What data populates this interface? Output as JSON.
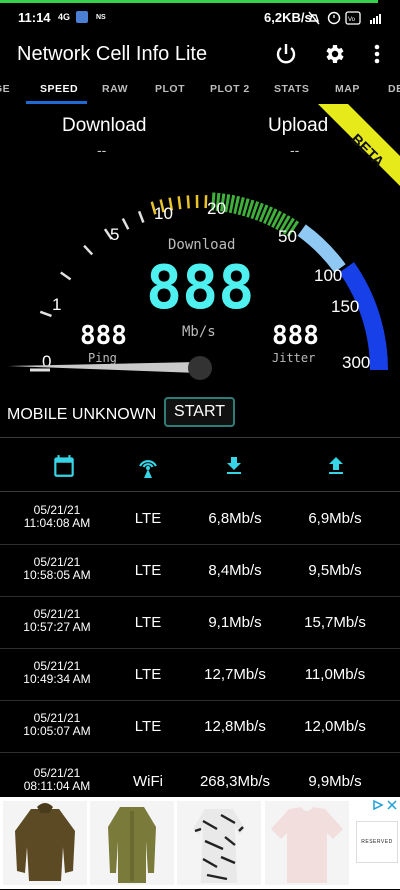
{
  "status_bar": {
    "time": "11:14",
    "network_left": "4G",
    "ns": "NS",
    "speed": "6,2KB/s",
    "right_icons": [
      "mute-icon",
      "alarm-icon",
      "volte-icon",
      "signal-icon"
    ]
  },
  "app_bar": {
    "title": "Network Cell Info Lite",
    "icons": [
      "power-icon",
      "settings-icon",
      "more-vert-icon"
    ]
  },
  "tabs": [
    {
      "label": "GE"
    },
    {
      "label": "SPEED",
      "active": true
    },
    {
      "label": "RAW"
    },
    {
      "label": "PLOT"
    },
    {
      "label": "PLOT 2"
    },
    {
      "label": "STATS"
    },
    {
      "label": "MAP"
    },
    {
      "label": "DE"
    }
  ],
  "speed": {
    "download_label": "Download",
    "download_value": "--",
    "upload_label": "Upload",
    "upload_value": "--",
    "beta": "BETA"
  },
  "gauge": {
    "scale_labels": [
      "0",
      "1",
      "5",
      "10",
      "20",
      "50",
      "100",
      "150",
      "300"
    ],
    "center_label": "Download",
    "center_digits": "888",
    "unit": "Mb/s",
    "ping_digits": "888",
    "ping_label": "Ping",
    "jitter_digits": "888",
    "jitter_label": "Jitter",
    "colors": {
      "yellow": "#e8c32a",
      "green": "#3fb13a",
      "light_blue": "#8ec8f3",
      "blue": "#1740e8",
      "digits": "#4ef0f0"
    }
  },
  "controls": {
    "mobile_status": "MOBILE UNKNOWN",
    "start_label": "START"
  },
  "history_icons": [
    "calendar-icon",
    "antenna-icon",
    "download-icon",
    "upload-icon"
  ],
  "history": [
    {
      "date": "05/21/21",
      "time": "11:04:08 AM",
      "tech": "LTE",
      "down": "6,8Mb/s",
      "up": "6,9Mb/s"
    },
    {
      "date": "05/21/21",
      "time": "10:58:05 AM",
      "tech": "LTE",
      "down": "8,4Mb/s",
      "up": "9,5Mb/s"
    },
    {
      "date": "05/21/21",
      "time": "10:57:27 AM",
      "tech": "LTE",
      "down": "9,1Mb/s",
      "up": "15,7Mb/s"
    },
    {
      "date": "05/21/21",
      "time": "10:49:34 AM",
      "tech": "LTE",
      "down": "12,7Mb/s",
      "up": "11,0Mb/s"
    },
    {
      "date": "05/21/21",
      "time": "10:05:07 AM",
      "tech": "LTE",
      "down": "12,8Mb/s",
      "up": "12,0Mb/s"
    },
    {
      "date": "05/21/21",
      "time": "08:11:04 AM",
      "tech": "WiFi",
      "down": "268,3Mb/s",
      "up": "9,9Mb/s"
    }
  ],
  "ad": {
    "brand_text": "RESERVED",
    "ad_choices": "ad-choices-icon"
  }
}
